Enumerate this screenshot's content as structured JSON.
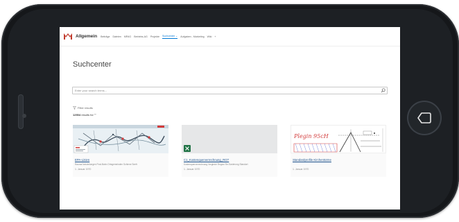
{
  "site": {
    "title": "Allgemein",
    "nav": [
      {
        "label": "Beiträge"
      },
      {
        "label": "Dateien"
      },
      {
        "label": "MR4G"
      },
      {
        "label": "Betriebs-AG"
      },
      {
        "label": "Projekte"
      },
      {
        "label": "Suchcenter ⌄",
        "active": true
      },
      {
        "label": "Aufgaben - Marketing"
      },
      {
        "label": "Wiki"
      },
      {
        "label": "+"
      }
    ]
  },
  "page": {
    "title": "Suchcenter"
  },
  "search": {
    "placeholder": "Enter your search terms..."
  },
  "filter": {
    "label": "Filter results"
  },
  "results": {
    "count": "12904",
    "suffix": " results for \"\""
  },
  "cards": [
    {
      "title": "EPA-Linien",
      "description": "Rauma Netzleitungen Post-Bahn Ortsgemeinden Schiene Seefr",
      "date": "1. Januar 1970"
    },
    {
      "title": "C1_Kostenquerverrechnung_RGT",
      "description": "Kostenquerverrechnung Vergleich Region Re-Sanierung Standort",
      "date": "1. Januar 1970"
    },
    {
      "title": "Standardprofile Kirchentürme",
      "description": "",
      "date": "1. Januar 1970"
    }
  ],
  "handwritten": "Plegin 95cH",
  "colors": {
    "accent": "#0078d4",
    "link": "#1a4f8a",
    "logo": "#c0392b",
    "excel": "#217346"
  },
  "icons": {
    "logo": "site-logo",
    "search": "search-icon",
    "filter": "filter-icon",
    "back": "back-icon",
    "excel": "excel-icon"
  }
}
